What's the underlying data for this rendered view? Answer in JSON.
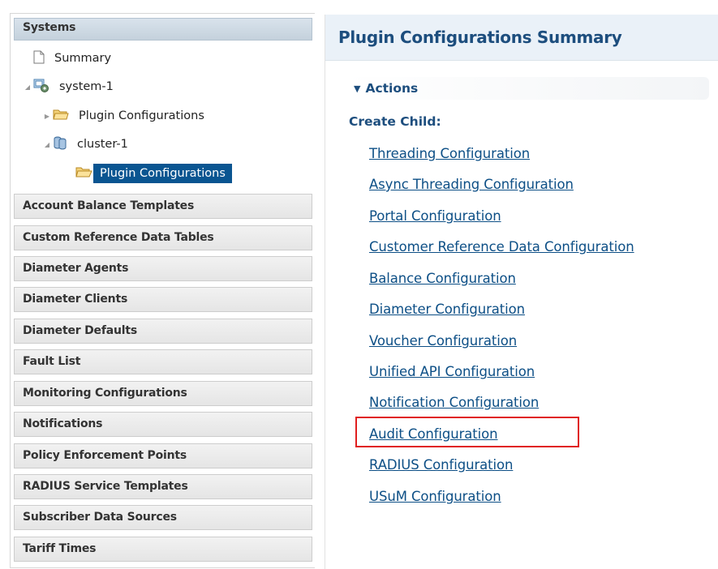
{
  "nav": {
    "systems_header": "Systems",
    "tree": {
      "summary": "Summary",
      "system": "system-1",
      "system_plugin_configs": "Plugin Configurations",
      "cluster": "cluster-1",
      "cluster_plugin_configs": "Plugin Configurations"
    },
    "sections": [
      "Account Balance Templates",
      "Custom Reference Data Tables",
      "Diameter Agents",
      "Diameter Clients",
      "Diameter Defaults",
      "Fault List",
      "Monitoring Configurations",
      "Notifications",
      "Policy Enforcement Points",
      "RADIUS Service Templates",
      "Subscriber Data Sources",
      "Tariff Times"
    ]
  },
  "main": {
    "title": "Plugin Configurations Summary",
    "actions_label": "Actions",
    "create_child_label": "Create Child:",
    "links": [
      "Threading Configuration",
      "Async Threading Configuration",
      "Portal Configuration",
      "Customer Reference Data Configuration",
      "Balance Configuration",
      "Diameter Configuration",
      "Voucher Configuration",
      "Unified API Configuration",
      "Notification Configuration",
      "Audit Configuration",
      "RADIUS Configuration",
      "USuM Configuration"
    ],
    "highlighted_link": "Audit Configuration"
  },
  "colors": {
    "selected_bg": "#0a5591",
    "link": "#0d4f86",
    "heading": "#1d4e7e",
    "highlight": "#e01e1e"
  }
}
